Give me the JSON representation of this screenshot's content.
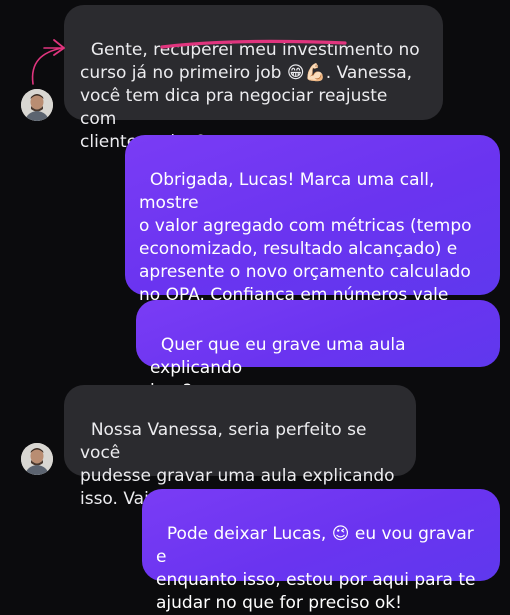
{
  "messages": [
    {
      "id": "msg1",
      "direction": "incoming",
      "text": "Gente, recuperei meu investimento no\ncurso já no primeiro job 😁💪🏻. Vanessa,\nvocê tem dica pra negociar reajuste com\ncliente antigo?"
    },
    {
      "id": "msg2",
      "direction": "outgoing",
      "text": "Obrigada, Lucas! Marca uma call, mostre\no valor agregado com métricas (tempo\neconomizado, resultado alcançado) e\napresente o novo orçamento calculado\nno OPA. Confiança em números vale\nouro!"
    },
    {
      "id": "msg3",
      "direction": "outgoing",
      "text": "Quer que eu grave uma aula explicando\nisso?"
    },
    {
      "id": "msg4",
      "direction": "incoming",
      "text": "Nossa Vanessa, seria perfeito se você\npudesse gravar uma aula explicando\nisso. Vai me ajudar muito! Obrigado"
    },
    {
      "id": "msg5",
      "direction": "outgoing",
      "text": "Pode deixar Lucas, 😉 eu vou gravar e\nenquanto isso, estou por aqui para te\najudar no que for preciso ok!"
    }
  ],
  "annotation": {
    "color": "#e0357e",
    "kind": "highlight-arrow"
  },
  "colors": {
    "background": "#0b0b0d",
    "incoming_bubble": "#2b2b2f",
    "outgoing_bubble": "#6a34f0"
  }
}
